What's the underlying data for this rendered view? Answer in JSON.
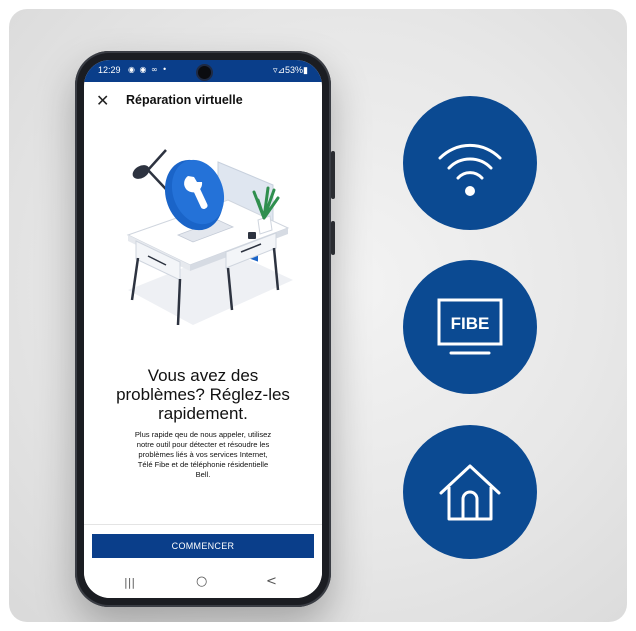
{
  "status_bar": {
    "time": "12:29",
    "left_icons": "◉ ◉ ∞ •",
    "right_text": "▿⊿53%▮"
  },
  "app": {
    "title": "Réparation virtuelle",
    "close_symbol": "✕"
  },
  "content": {
    "headline_line1": "Vous avez des",
    "headline_line2": "problèmes? Réglez-les",
    "headline_line3": "rapidement.",
    "body_line1": "Plus rapide qeu de nous appeler, utilisez",
    "body_line2": "notre outil pour détecter et résoudre les",
    "body_line3": "problèmes liés à vos services Internet,",
    "body_line4": "Télé Fibe et de téléphonie résidentielle",
    "body_line5": "Bell.",
    "cta_label": "COMMENCER"
  },
  "navbar": {
    "recent": "|||",
    "home": "○",
    "back": "<"
  },
  "service_icons": {
    "wifi": "wifi-icon",
    "tv_label": "FIBE",
    "home": "home-icon"
  },
  "colors": {
    "brand_blue": "#0b4a92",
    "status_blue": "#0a3e8a"
  }
}
